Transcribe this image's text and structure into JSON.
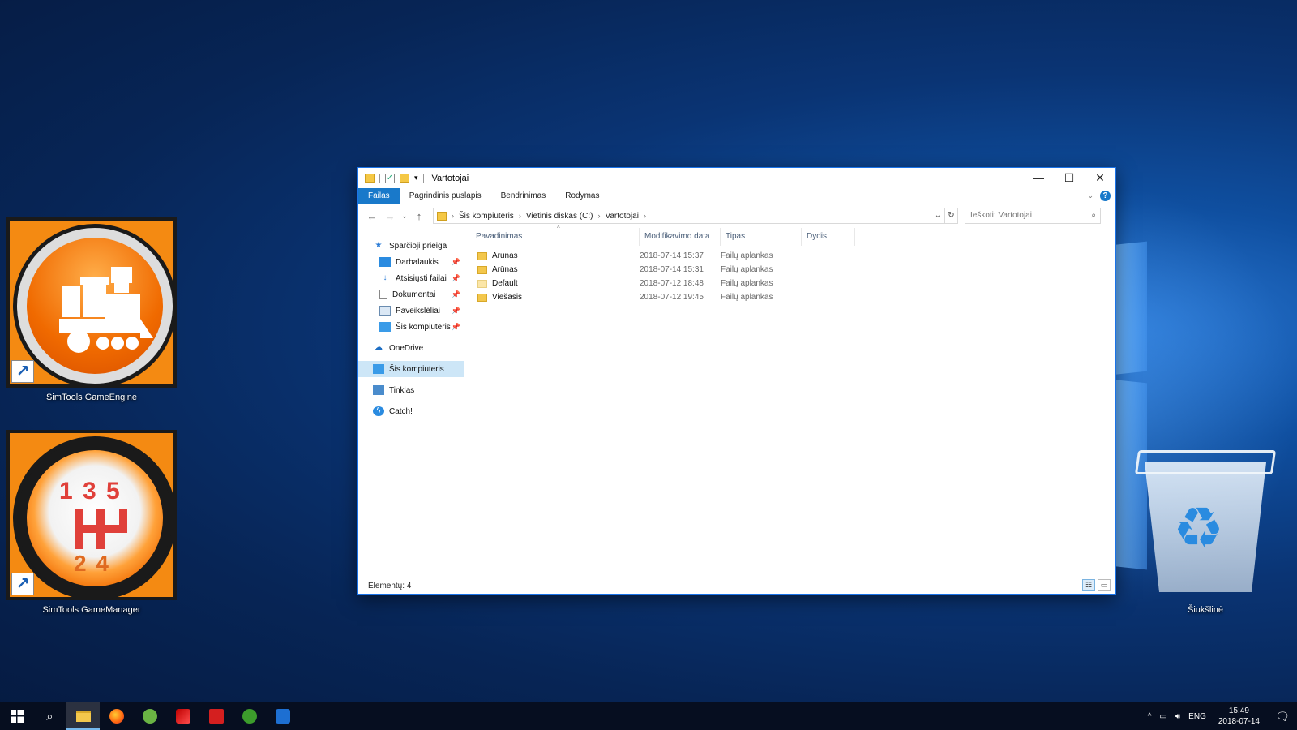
{
  "desktop": {
    "icons": [
      {
        "label": "SimTools GameEngine"
      },
      {
        "label": "SimTools GameManager",
        "gear_digits_top": "1 3 5",
        "gear_digits_bottom": "2 4"
      },
      {
        "label": "Šiukšlinė"
      }
    ]
  },
  "window": {
    "title": "Vartotojai",
    "ribbon_tabs": [
      "Failas",
      "Pagrindinis puslapis",
      "Bendrinimas",
      "Rodymas"
    ],
    "help_label": "?",
    "address": {
      "crumbs": [
        "Šis kompiuteris",
        "Vietinis diskas (C:)",
        "Vartotojai"
      ]
    },
    "search": {
      "placeholder": "Ieškoti: Vartotojai"
    },
    "nav": {
      "quick_access": "Sparčioji prieiga",
      "pinned": [
        "Darbalaukis",
        "Atsisiųsti failai",
        "Dokumentai",
        "Paveikslėliai",
        "Šis kompiuteris"
      ],
      "onedrive": "OneDrive",
      "this_pc": "Šis kompiuteris",
      "network": "Tinklas",
      "catch": "Catch!"
    },
    "columns": [
      "Pavadinimas",
      "Modifikavimo data",
      "Tipas",
      "Dydis"
    ],
    "rows": [
      {
        "name": "Arunas",
        "date": "2018-07-14 15:37",
        "type": "Failų aplankas"
      },
      {
        "name": "Arūnas",
        "date": "2018-07-14 15:31",
        "type": "Failų aplankas"
      },
      {
        "name": "Default",
        "date": "2018-07-12 18:48",
        "type": "Failų aplankas"
      },
      {
        "name": "Viešasis",
        "date": "2018-07-12 19:45",
        "type": "Failų aplankas"
      }
    ],
    "status": "Elementų: 4"
  },
  "taskbar": {
    "tray": {
      "language": "ENG",
      "time": "15:49",
      "date": "2018-07-14"
    },
    "apps": [
      "file-explorer",
      "firefox",
      "utorrent",
      "filezilla",
      "flash",
      "xbox",
      "teamviewer"
    ]
  },
  "colors": {
    "accent": "#1979ca",
    "desktop": "#0a3474",
    "simtools_orange": "#f48a12"
  }
}
